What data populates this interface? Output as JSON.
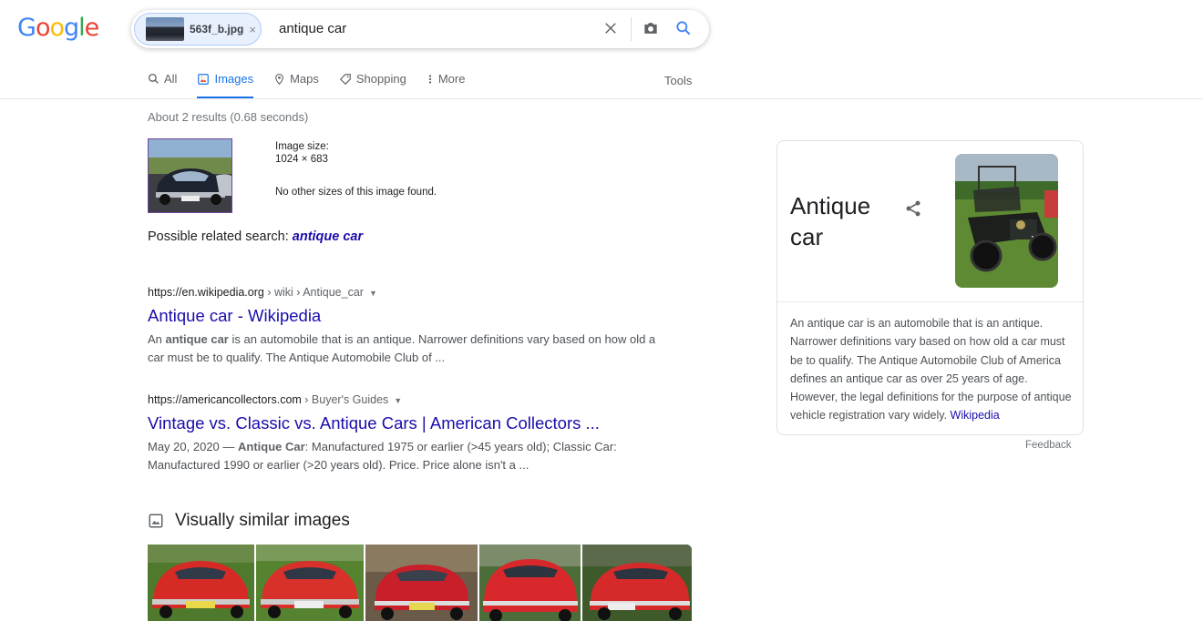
{
  "logo": {
    "letters": [
      "G",
      "o",
      "o",
      "g",
      "l",
      "e"
    ],
    "colors": [
      "#4285f4",
      "#ea4335",
      "#fbbc05",
      "#4285f4",
      "#34a853",
      "#ea4335"
    ]
  },
  "search": {
    "chip_label": "563f_b.jpg",
    "chip_close": "×",
    "query": "antique car"
  },
  "tabs": [
    {
      "label": "All",
      "icon": "search-icon"
    },
    {
      "label": "Images",
      "icon": "image-icon",
      "active": true
    },
    {
      "label": "Maps",
      "icon": "map-pin-icon"
    },
    {
      "label": "Shopping",
      "icon": "tag-icon"
    },
    {
      "label": "More",
      "icon": "more-vert-icon"
    }
  ],
  "tools_label": "Tools",
  "stats": "About 2 results (0.68 seconds)",
  "image_info": {
    "size_label": "Image size:",
    "size_value": "1024 × 683",
    "note": "No other sizes of this image found."
  },
  "related": {
    "prefix": "Possible related search:",
    "link": "antique car"
  },
  "results": [
    {
      "domain": "https://en.wikipedia.org",
      "crumb": " › wiki › Antique_car",
      "title": "Antique car - Wikipedia",
      "snippet_parts": [
        "An ",
        "antique car",
        " is an automobile that is an antique. Narrower definitions vary based on how old a car must be to qualify. The Antique Automobile Club of ..."
      ]
    },
    {
      "domain": "https://americancollectors.com",
      "crumb": " › Buyer's Guides",
      "title": "Vintage vs. Classic vs. Antique Cars | American Collectors ...",
      "snippet_parts": [
        "May 20, 2020 — ",
        "Antique Car",
        ": Manufactured 1975 or earlier (>45 years old); Classic Car: Manufactured 1990 or earlier (>20 years old). Price. Price alone isn't a ..."
      ]
    }
  ],
  "similar": {
    "heading": "Visually similar images",
    "count": 5
  },
  "knowledge_panel": {
    "title": "Antique car",
    "description": "An antique car is an automobile that is an antique. Narrower definitions vary based on how old a car must be to qualify. The Antique Automobile Club of America defines an antique car as over 25 years of age. However, the legal definitions for the purpose of antique vehicle registration vary widely.",
    "source_link": "Wikipedia"
  },
  "feedback": "Feedback"
}
